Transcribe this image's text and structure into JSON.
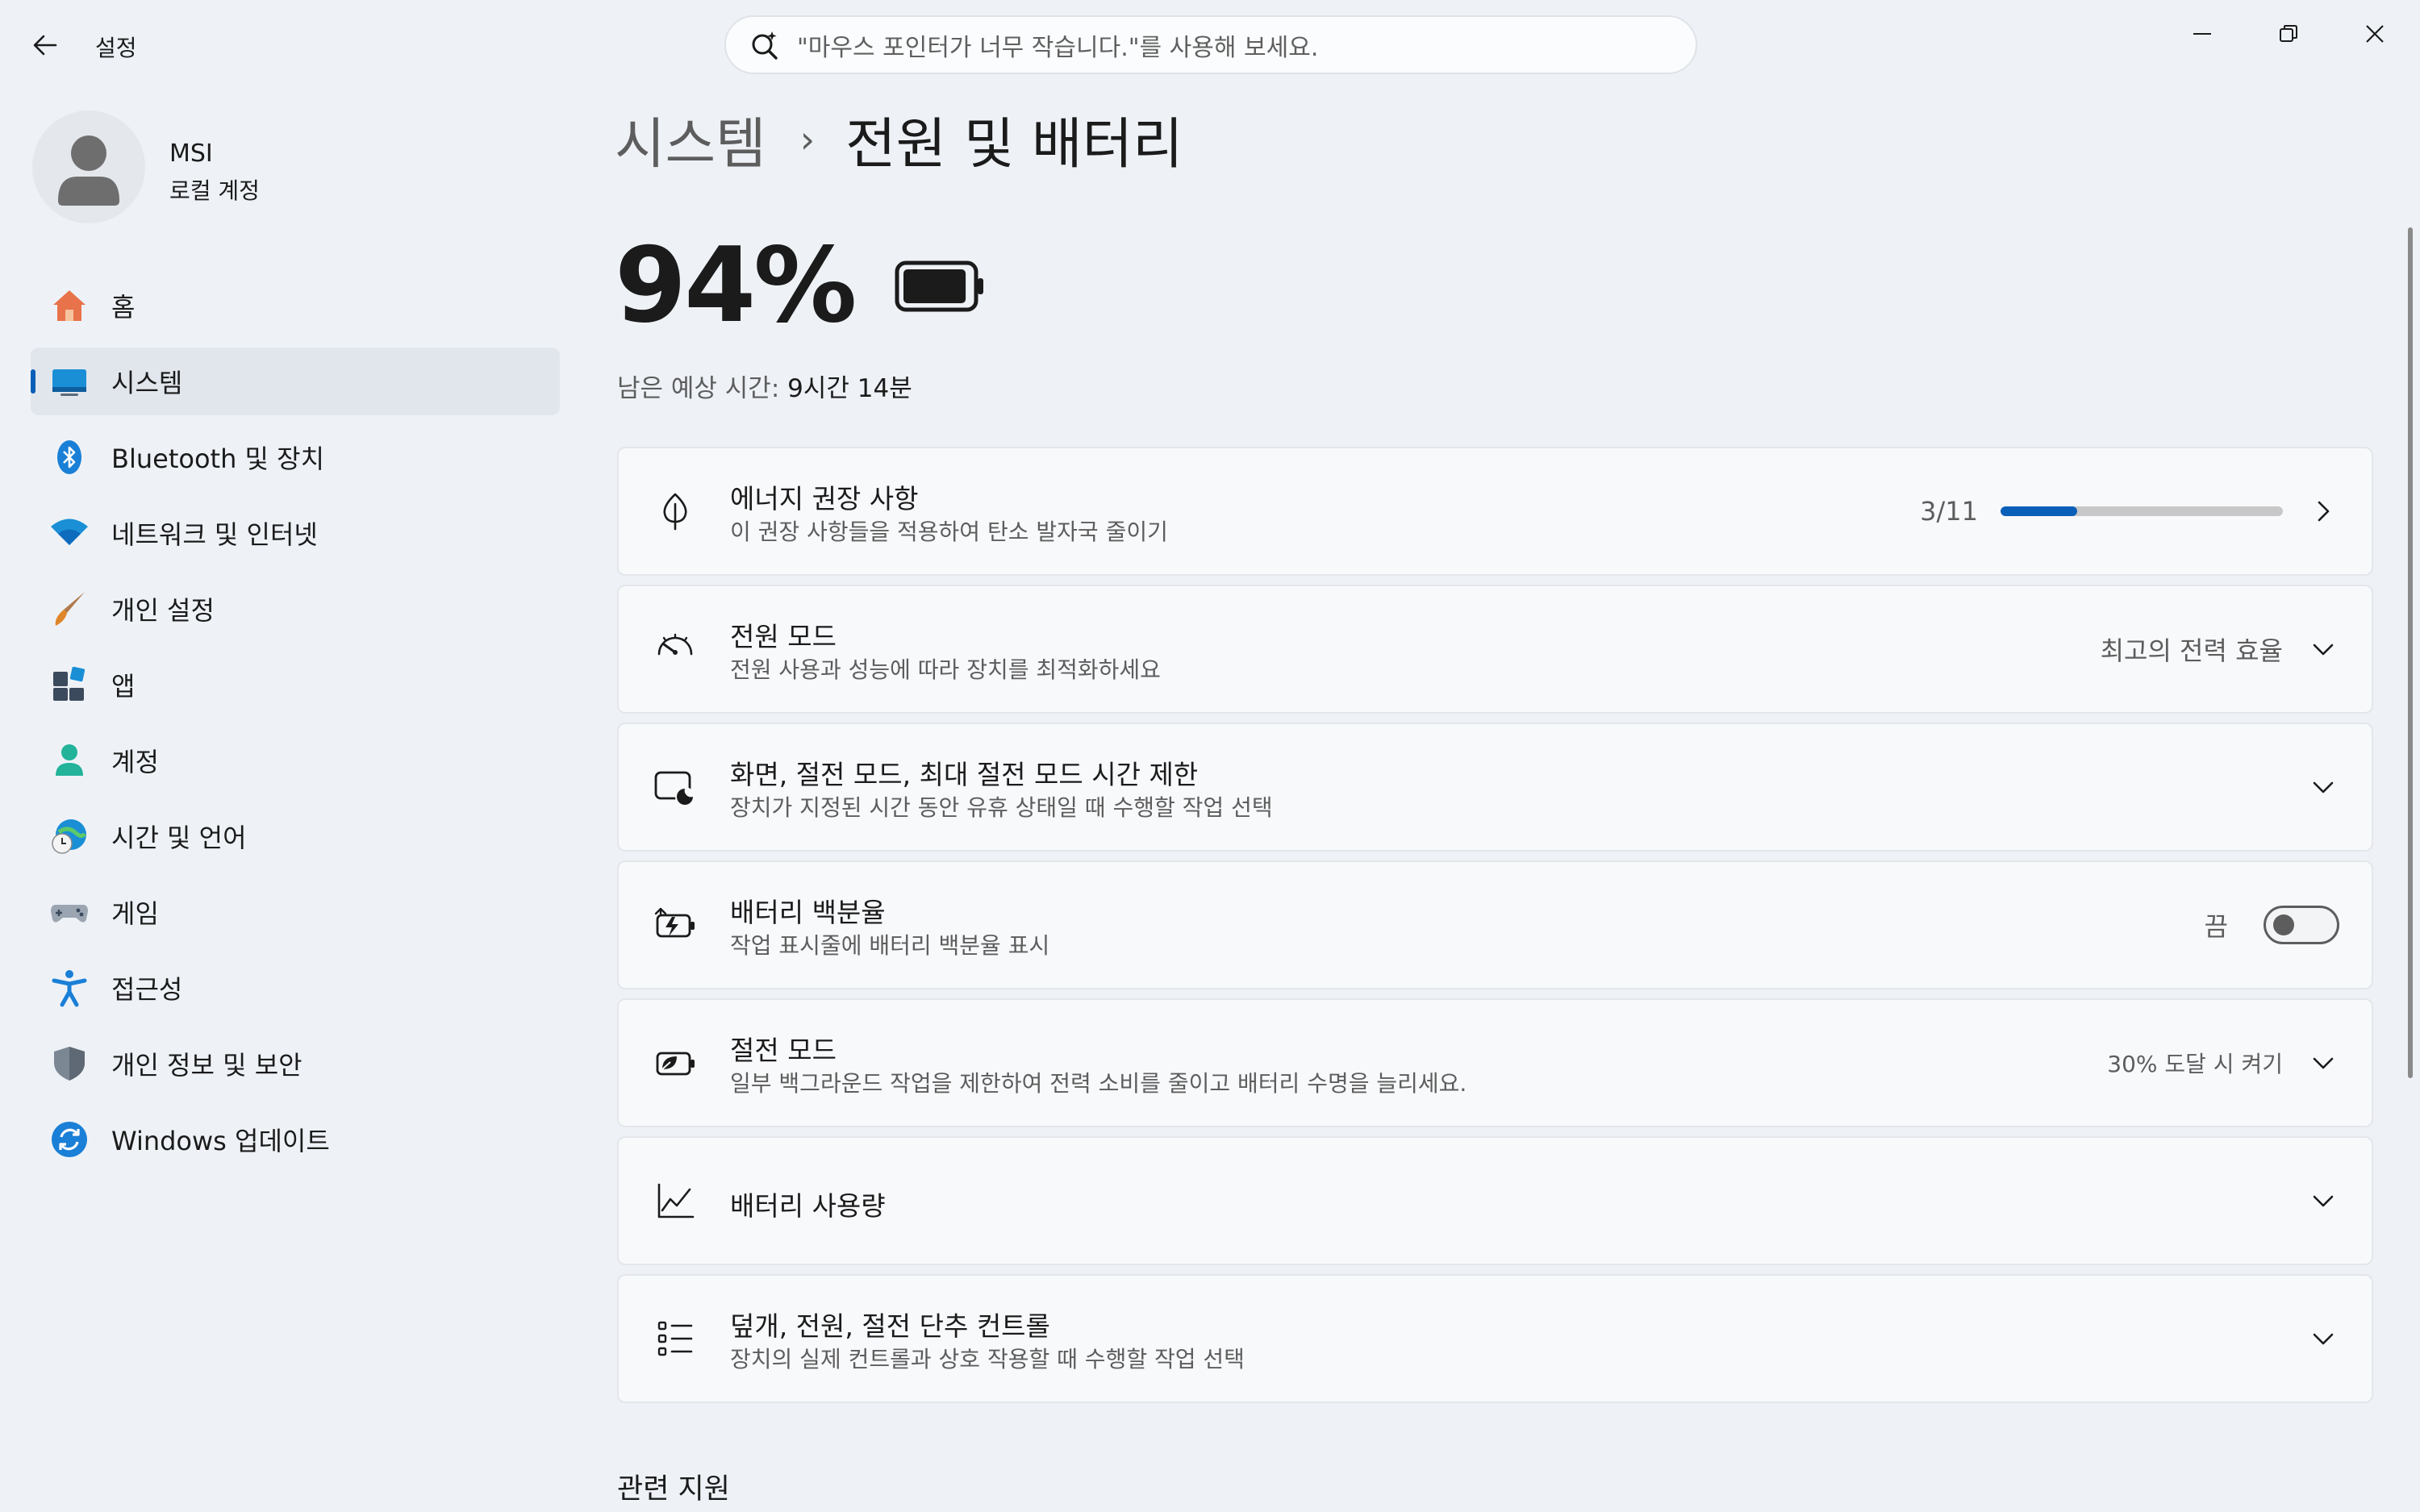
{
  "window": {
    "app_title": "설정",
    "search_placeholder": "\"마우스 포인터가 너무 작습니다.\"를 사용해 보세요."
  },
  "profile": {
    "name": "MSI",
    "account_type": "로컬 계정"
  },
  "sidebar": {
    "items": [
      {
        "label": "홈",
        "icon": "home-icon"
      },
      {
        "label": "시스템",
        "icon": "system-icon",
        "active": true
      },
      {
        "label": "Bluetooth 및 장치",
        "icon": "bluetooth-icon"
      },
      {
        "label": "네트워크 및 인터넷",
        "icon": "wifi-icon"
      },
      {
        "label": "개인 설정",
        "icon": "brush-icon"
      },
      {
        "label": "앱",
        "icon": "apps-icon"
      },
      {
        "label": "계정",
        "icon": "account-icon"
      },
      {
        "label": "시간 및 언어",
        "icon": "time-language-icon"
      },
      {
        "label": "게임",
        "icon": "gamepad-icon"
      },
      {
        "label": "접근성",
        "icon": "accessibility-icon"
      },
      {
        "label": "개인 정보 및 보안",
        "icon": "shield-icon"
      },
      {
        "label": "Windows 업데이트",
        "icon": "update-icon"
      }
    ]
  },
  "breadcrumb": {
    "parent": "시스템",
    "separator": "›",
    "current": "전원 및 배터리"
  },
  "battery": {
    "percent_text": "94%",
    "level_percent": 94,
    "remaining_label": "남은 예상 시간: ",
    "remaining_value": "9시간 14분"
  },
  "cards": {
    "energy": {
      "title": "에너지 권장 사항",
      "subtitle": "이 권장 사항들을 적용하여 탄소 발자국 줄이기",
      "progress_text": "3/11",
      "progress_fraction": 0.2727,
      "icon": "leaf-icon"
    },
    "power_mode": {
      "title": "전원 모드",
      "subtitle": "전원 사용과 성능에 따라 장치를 최적화하세요",
      "value": "최고의 전력 효율",
      "icon": "gauge-icon"
    },
    "screen_sleep": {
      "title": "화면, 절전 모드, 최대 절전 모드 시간 제한",
      "subtitle": "장치가 지정된 시간 동안 유휴 상태일 때 수행할 작업 선택",
      "icon": "screen-sleep-icon"
    },
    "battery_percentage": {
      "title": "배터리 백분율",
      "subtitle": "작업 표시줄에 배터리 백분율 표시",
      "toggle_label": "끔",
      "toggle_on": false,
      "icon": "battery-charge-icon"
    },
    "energy_saver": {
      "title": "절전 모드",
      "subtitle": "일부 백그라운드 작업을 제한하여 전력 소비를 줄이고 배터리 수명을 늘리세요.",
      "value": "30% 도달 시 켜기",
      "icon": "battery-saver-icon"
    },
    "battery_usage": {
      "title": "배터리 사용량",
      "icon": "chart-icon"
    },
    "lid_power": {
      "title": "덮개, 전원, 절전 단추 컨트롤",
      "subtitle": "장치의 실제 컨트롤과 상호 작용할 때 수행할 작업 선택",
      "icon": "list-icon"
    }
  },
  "related": {
    "title": "관련 지원"
  },
  "colors": {
    "accent": "#0a5fb8",
    "background": "#eef2f7",
    "card": "#f8f9fb"
  }
}
